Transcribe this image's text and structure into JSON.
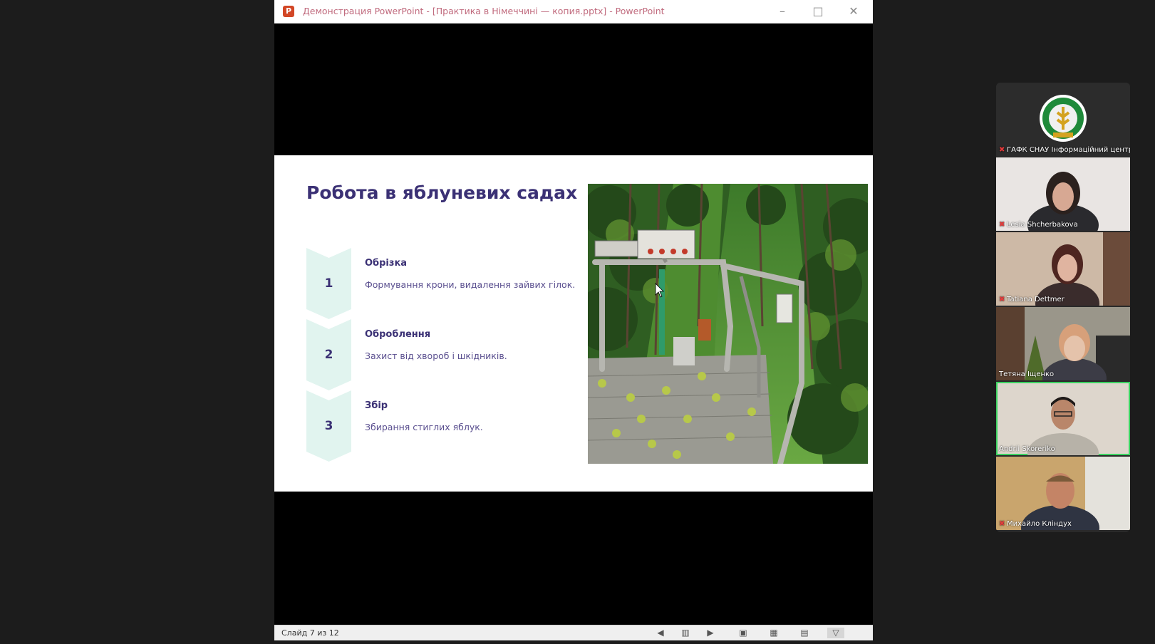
{
  "window": {
    "app_icon": "P",
    "title": "Демонстрация PowerPoint - [Практика в Німеччині — копия.pptx] - PowerPoint",
    "min_icon": "minimize-icon",
    "max_icon": "maximize-icon",
    "close_icon": "close-icon"
  },
  "slide": {
    "title": "Робота в яблуневих садах",
    "steps": [
      {
        "number": "1",
        "heading": "Обрізка",
        "text": "Формування крони, видалення зайвих гілок."
      },
      {
        "number": "2",
        "heading": "Оброблення",
        "text": "Захист від хвороб і шкідників."
      },
      {
        "number": "3",
        "heading": "Збір",
        "text": "Збирання стиглих яблук."
      }
    ]
  },
  "statusbar": {
    "slide_counter": "Слайд 7 из 12",
    "buttons": [
      "prev-slide-icon",
      "slide-menu-icon",
      "next-slide-icon",
      "normal-view-icon",
      "slide-sorter-icon",
      "reading-view-icon",
      "slideshow-icon"
    ]
  },
  "participants": [
    {
      "name": "ГАФК СНАУ Інформаційний центр",
      "muted": true
    },
    {
      "name": "Lesia Shcherbakova",
      "muted": true
    },
    {
      "name": "Tatiana Dettmer",
      "muted": true
    },
    {
      "name": "Тетяна Іщенко",
      "muted": false
    },
    {
      "name": "Andrii Skoreriko",
      "muted": false,
      "speaking": true
    },
    {
      "name": "Михайло Кліндух",
      "muted": true
    }
  ],
  "colors": {
    "slide_title": "#3b3175",
    "chevron_fill": "#e1f4ef",
    "active_speaker": "#3bd160",
    "ppt_icon": "#d24726"
  }
}
